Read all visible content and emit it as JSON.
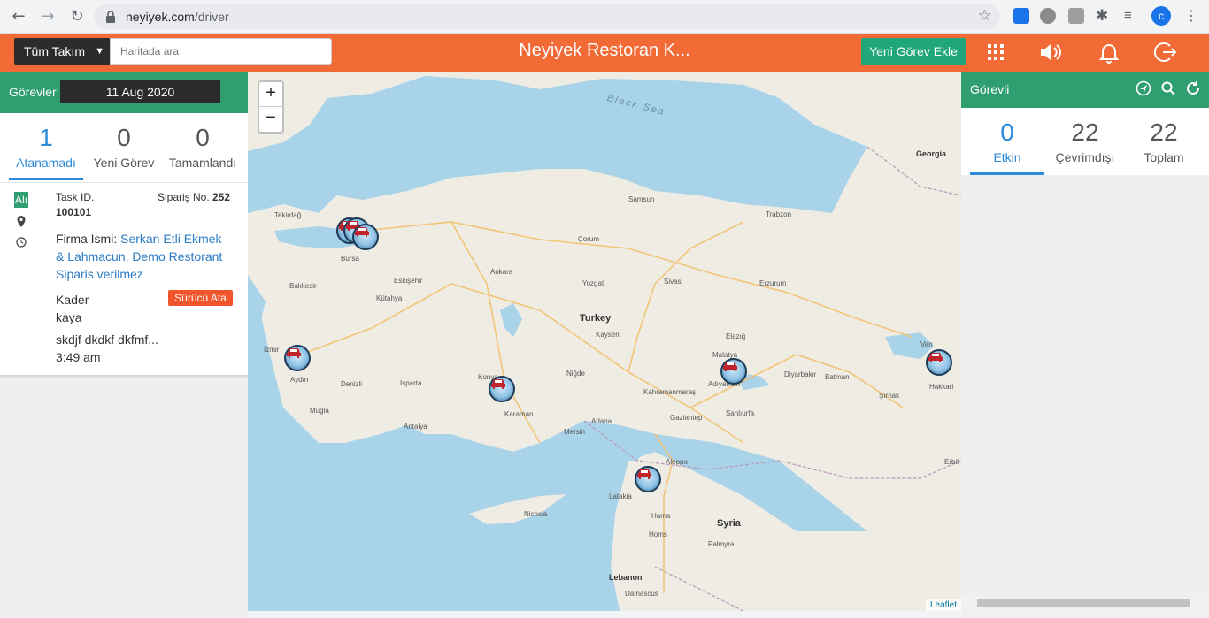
{
  "browser": {
    "url_host": "neyiyek.com",
    "url_path": "/driver",
    "profile_initial": "c"
  },
  "header": {
    "team_select_value": "Tüm Takım",
    "search_placeholder": "Haritada ara",
    "title": "Neyiyek Restoran K...",
    "new_task_label": "Yeni Görev Ekle",
    "icons": [
      "apps-grid-icon",
      "volume-icon",
      "bell-icon",
      "logout-icon"
    ],
    "accent_color": "#f26a35"
  },
  "left_panel": {
    "title": "Görevler",
    "date": "11 Aug 2020",
    "tabs": [
      {
        "count": "1",
        "label": "Atanamadı",
        "active": true
      },
      {
        "count": "0",
        "label": "Yeni Görev",
        "active": false
      },
      {
        "count": "0",
        "label": "Tamamlandı",
        "active": false
      }
    ],
    "task": {
      "status_badge": "Alı",
      "task_id_label": "Task ID.",
      "task_id": "100101",
      "order_label": "Sipariş No.",
      "order_no": "252",
      "company_prefix": "Firma İsmi:",
      "company_link": "Serkan Etli Ekmek & Lahmacun, Demo Restorant Siparis verilmez",
      "assign_label": "Sürücü Ata",
      "name_first": "Kader",
      "name_last": "kaya",
      "address": "skdjf dkdkf dkfmf...",
      "time": "3:49 am"
    }
  },
  "map": {
    "zoom_in": "+",
    "zoom_out": "−",
    "attribution": "Leaflet",
    "labels": {
      "black_sea": "Black Sea",
      "turkey": "Turkey",
      "syria": "Syria",
      "lebanon": "Lebanon",
      "georgia": "Georgia",
      "ankara": "Ankara",
      "samsun": "Samsun",
      "trabzon": "Trabzon",
      "bursa": "Bursa",
      "izmir": "İzmir",
      "konya": "Konya",
      "kayseri": "Kayseri",
      "sivas": "Sivas",
      "erzurum": "Erzurum",
      "antalya": "Antalya",
      "adana": "Adana",
      "mersin": "Mersin",
      "gaziantep": "Gaziantep",
      "aleppo": "Aleppo",
      "malatya": "Malatya",
      "diyarbakir": "Diyarbakır",
      "van": "Van",
      "nicosia": "Nicosia",
      "hama": "Hama",
      "homs": "Homs",
      "damascus": "Damascus",
      "eskisehir": "Eskişehir",
      "denizli": "Denizli",
      "aydin": "Aydın",
      "mugla": "Muğla",
      "kutahya": "Kütahya",
      "corum": "Çorum",
      "yozgat": "Yozgat",
      "elazig": "Elazığ",
      "sanliurfa": "Şanlıurfa",
      "batman": "Batman",
      "latakia": "Latakia",
      "tekirdag": "Tekirdağ",
      "balikesir": "Balıkesir",
      "isparta": "Isparta",
      "karaman": "Karaman",
      "nigde": "Niğde",
      "kahramanmaras": "Kahramanmaraş",
      "adiyaman": "Adıyaman",
      "palmyra": "Palmyra",
      "hakkari": "Hakkari",
      "sirnak": "Şırnak",
      "erbil": "Erbil"
    }
  },
  "right_panel": {
    "title": "Görevli",
    "tabs": [
      {
        "count": "0",
        "label": "Etkin",
        "active": true
      },
      {
        "count": "22",
        "label": "Çevrimdışı",
        "active": false
      },
      {
        "count": "22",
        "label": "Toplam",
        "active": false
      }
    ]
  }
}
